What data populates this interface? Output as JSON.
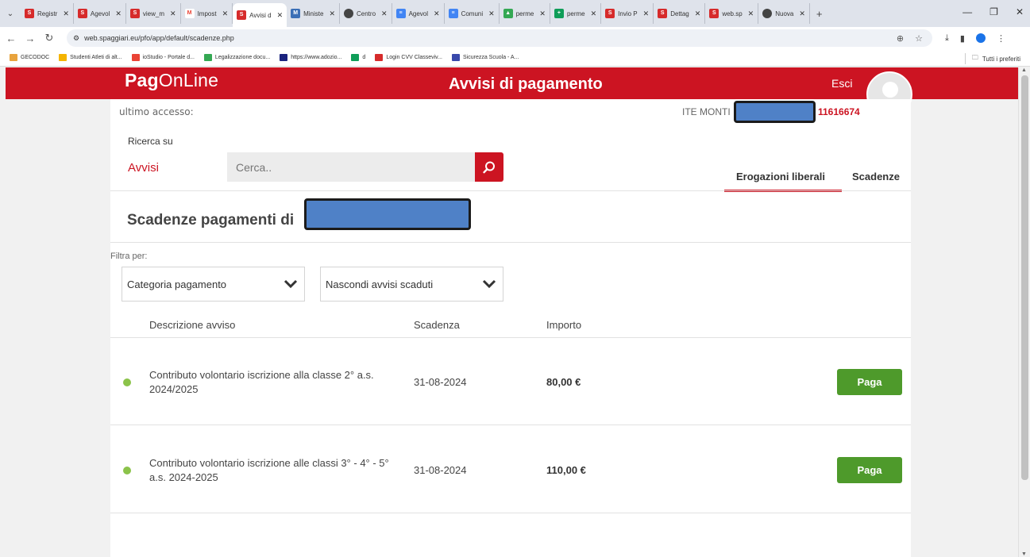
{
  "browser": {
    "tabs": [
      {
        "label": "Registr",
        "color": "#d62b2b"
      },
      {
        "label": "Agevol",
        "color": "#d62b2b"
      },
      {
        "label": "view_m",
        "color": "#d62b2b"
      },
      {
        "label": "Impost",
        "color": "#ea4335"
      },
      {
        "label": "Avvisi d",
        "color": "#d62b2b",
        "active": true
      },
      {
        "label": "Ministe",
        "color": "#3b6fb6"
      },
      {
        "label": "Centro",
        "color": "#444444"
      },
      {
        "label": "Agevol",
        "color": "#4285f4"
      },
      {
        "label": "Comuni",
        "color": "#4285f4"
      },
      {
        "label": "perme",
        "color": "#34a853"
      },
      {
        "label": "perme",
        "color": "#0f9d58"
      },
      {
        "label": "Invio P",
        "color": "#d62b2b"
      },
      {
        "label": "Dettag",
        "color": "#d62b2b"
      },
      {
        "label": "web.sp",
        "color": "#d62b2b"
      },
      {
        "label": "Nuova",
        "color": "#444444"
      }
    ],
    "url": "web.spaggiari.eu/pfo/app/default/scadenze.php",
    "bookmarks": [
      {
        "label": "GECODOC",
        "color": "#e8a33d"
      },
      {
        "label": "Studenti Atleti di alt...",
        "color": "#f4b400"
      },
      {
        "label": "ioStudio - Portale d...",
        "color": "#ea4335"
      },
      {
        "label": "Legalizzazione docu...",
        "color": "#34a853"
      },
      {
        "label": "https://www.adozio...",
        "color": "#1a237e"
      },
      {
        "label": "d",
        "color": "#0f9d58"
      },
      {
        "label": "Login CVV Classeviv...",
        "color": "#d62b2b"
      },
      {
        "label": "Sicurezza Scuola - A...",
        "color": "#3949ab"
      }
    ],
    "all_bookmarks": "Tutti i preferiti"
  },
  "header": {
    "logo_bold": "Pag",
    "logo_rest": "OnLine",
    "title": "Avvisi di pagamento",
    "logout": "Esci",
    "brand_color": "#cc1422"
  },
  "user": {
    "last_access": "ultimo accesso:",
    "school": "ITE MONTI",
    "code": "11616674"
  },
  "search": {
    "label": "Ricerca su",
    "scope": "Avvisi",
    "placeholder": "Cerca.."
  },
  "tabs": {
    "erogazioni": "Erogazioni liberali",
    "scadenze": "Scadenze"
  },
  "section": {
    "title": "Scadenze pagamenti di"
  },
  "filters": {
    "label": "Filtra per:",
    "category": "Categoria pagamento",
    "hide_expired": "Nascondi avvisi scaduti"
  },
  "table": {
    "headers": [
      "Descrizione avviso",
      "Scadenza",
      "Importo"
    ],
    "rows": [
      {
        "description": "Contributo volontario iscrizione alla classe 2° a.s. 2024/2025",
        "deadline": "31-08-2024",
        "amount": "80,00 €",
        "action": "Paga"
      },
      {
        "description": "Contributo volontario iscrizione alle classi 3° - 4° - 5° a.s. 2024-2025",
        "deadline": "31-08-2024",
        "amount": "110,00 €",
        "action": "Paga"
      }
    ]
  }
}
